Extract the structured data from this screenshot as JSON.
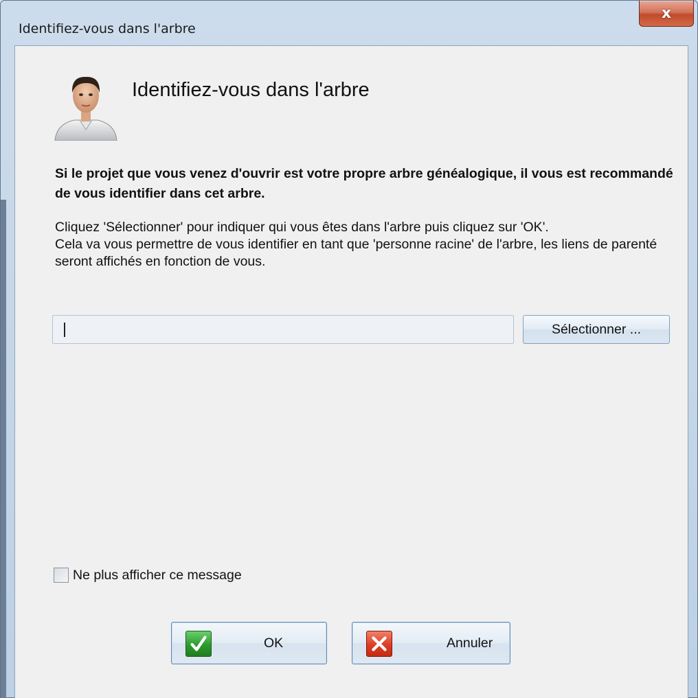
{
  "window": {
    "title": "Identifiez-vous dans l'arbre",
    "close_label": "x"
  },
  "header": {
    "avatar_icon": "person-avatar-icon",
    "title": "Identifiez-vous dans l'arbre"
  },
  "content": {
    "intro_bold": "Si le projet que vous venez d'ouvrir est votre propre arbre généalogique, il vous est recommandé de vous identifier dans cet arbre.",
    "instruction_line1": "Cliquez 'Sélectionner' pour indiquer qui vous êtes dans l'arbre puis cliquez sur 'OK'.",
    "instruction_line2": "Cela va vous permettre de vous identifier en tant que 'personne racine' de l'arbre, les liens de parenté seront affichés en fonction de vous."
  },
  "root_person": {
    "value": "",
    "select_label": "Sélectionner ..."
  },
  "options": {
    "dont_show_label": "Ne plus afficher ce message",
    "dont_show_checked": false
  },
  "buttons": {
    "ok_label": "OK",
    "ok_icon": "checkmark-icon",
    "cancel_label": "Annuler",
    "cancel_icon": "x-icon"
  },
  "colors": {
    "ok_green": "#2e9a2e",
    "cancel_red": "#dc3d24",
    "close_red": "#c24a2c"
  }
}
